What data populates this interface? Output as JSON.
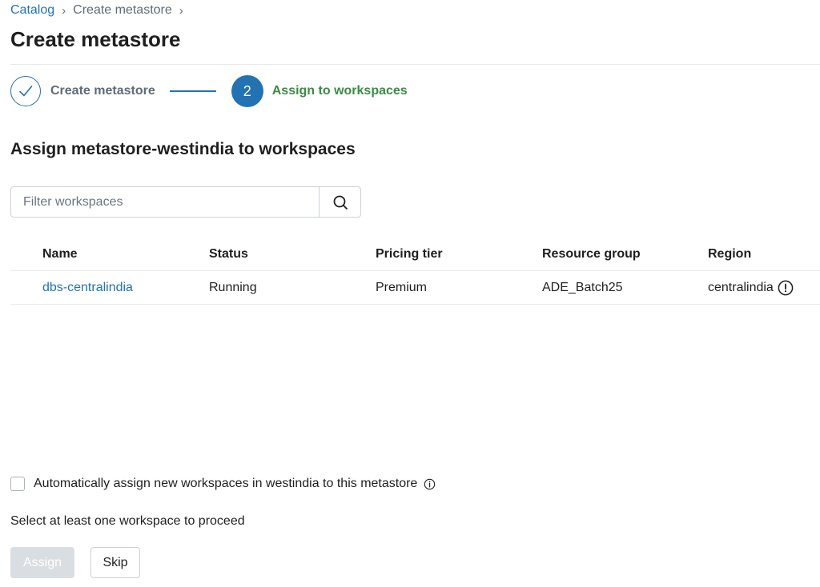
{
  "breadcrumb": {
    "items": [
      "Catalog",
      "Create metastore"
    ],
    "separator": "›"
  },
  "page": {
    "title": "Create metastore"
  },
  "stepper": {
    "steps": [
      {
        "number": "1",
        "label": "Create metastore",
        "state": "completed"
      },
      {
        "number": "2",
        "label": "Assign to workspaces",
        "state": "active"
      }
    ]
  },
  "section": {
    "title": "Assign metastore-westindia to workspaces"
  },
  "search": {
    "placeholder": "Filter workspaces",
    "value": "",
    "icon": "search-icon"
  },
  "table": {
    "columns": [
      "Name",
      "Status",
      "Pricing tier",
      "Resource group",
      "Region"
    ],
    "rows": [
      {
        "name": "dbs-centralindia",
        "status": "Running",
        "pricing_tier": "Premium",
        "resource_group": "ADE_Batch25",
        "region": "centralindia",
        "region_icon": "warning-circle-icon"
      }
    ]
  },
  "auto_assign": {
    "label": "Automatically assign new workspaces in westindia to this metastore",
    "checked": false,
    "icon": "info-icon"
  },
  "hint": "Select at least one workspace to proceed",
  "actions": {
    "assign_label": "Assign",
    "assign_disabled": true,
    "skip_label": "Skip"
  },
  "colors": {
    "accent": "#2272b4",
    "active_step_text": "#3c8a44",
    "disabled_button": "#d9dee3"
  }
}
